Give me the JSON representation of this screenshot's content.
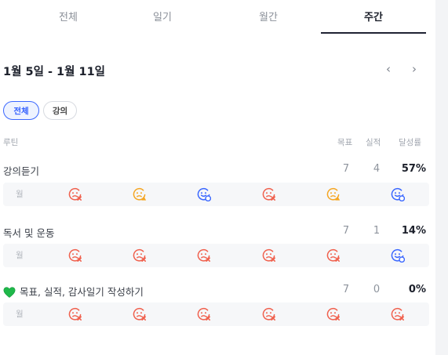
{
  "tabs": [
    {
      "label": "전체",
      "active": false
    },
    {
      "label": "일기",
      "active": false
    },
    {
      "label": "월간",
      "active": false
    },
    {
      "label": "주간",
      "active": true
    }
  ],
  "range_title": "1월 5일 - 1월 11일",
  "nav": {
    "prev": "‹",
    "next": "›"
  },
  "filters": [
    {
      "label": "전체",
      "selected": true
    },
    {
      "label": "강의",
      "selected": false
    }
  ],
  "columns": {
    "routine": "루틴",
    "goal": "목표",
    "actual": "실적",
    "rate": "달성률"
  },
  "routines": [
    {
      "name": "강의듣기",
      "goal": "7",
      "actual": "4",
      "rate": "57%",
      "day_label": "월",
      "days": [
        "fail",
        "partial",
        "success",
        "fail",
        "partial",
        "success"
      ]
    },
    {
      "name": "독서 및 운동",
      "goal": "7",
      "actual": "1",
      "rate": "14%",
      "day_label": "월",
      "days": [
        "fail",
        "fail",
        "fail",
        "fail",
        "fail",
        "success"
      ]
    },
    {
      "name": "목표, 실적, 감사일기 작성하기",
      "goal": "7",
      "actual": "0",
      "rate": "0%",
      "day_label": "월",
      "has_heart_icon": true,
      "days": [
        "fail",
        "fail",
        "fail",
        "fail",
        "fail",
        "fail"
      ]
    }
  ],
  "status_icons": {
    "fail": "sad-face-x-icon",
    "partial": "sad-face-warning-icon",
    "success": "smile-face-check-icon"
  },
  "colors": {
    "fail": "#f0604d",
    "partial": "#f5a623",
    "success": "#3a67ff",
    "heart": "#1fb84a",
    "accent": "#3360ff"
  }
}
